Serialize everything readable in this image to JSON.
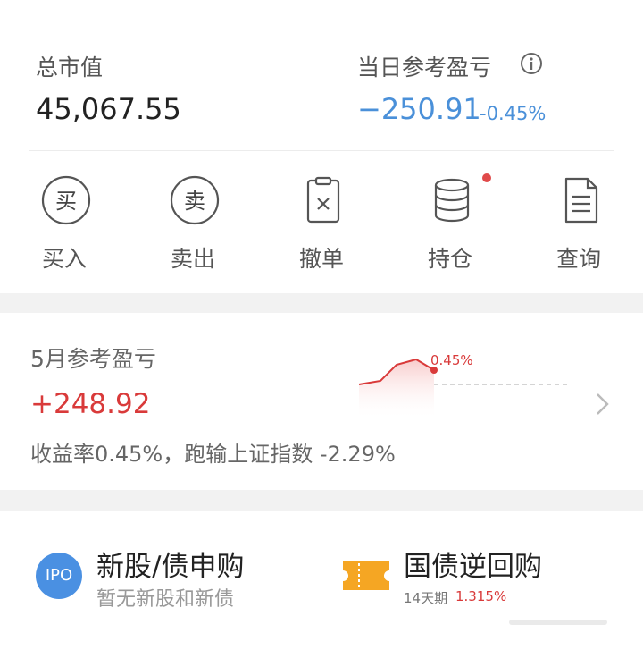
{
  "summary": {
    "total_value_label": "总市值",
    "total_value": "45,067.55",
    "daily_pnl_label": "当日参考盈亏",
    "daily_pnl_value": "−250.91",
    "daily_pnl_pct": "-0.45%"
  },
  "actions": [
    {
      "label": "买入",
      "icon": "buy-icon",
      "glyph": "买"
    },
    {
      "label": "卖出",
      "icon": "sell-icon",
      "glyph": "卖"
    },
    {
      "label": "撤单",
      "icon": "cancel-order-icon"
    },
    {
      "label": "持仓",
      "icon": "holdings-icon",
      "has_notification_dot": true
    },
    {
      "label": "查询",
      "icon": "query-icon"
    }
  ],
  "monthly": {
    "title": "5月参考盈亏",
    "value": "+248.92",
    "pct_marker": "0.45%",
    "footer": "收益率0.45%，跑输上证指数 -2.29%"
  },
  "services": {
    "ipo": {
      "badge": "IPO",
      "title": "新股/债申购",
      "subtitle": "暂无新股和新债"
    },
    "repo": {
      "title": "国债逆回购",
      "term": "14天期",
      "rate": "1.315%"
    }
  },
  "colors": {
    "negative": "#4a90d9",
    "positive": "#d93a3a",
    "ipo_badge": "#4a90e2",
    "repo_ticket": "#f5a623"
  }
}
